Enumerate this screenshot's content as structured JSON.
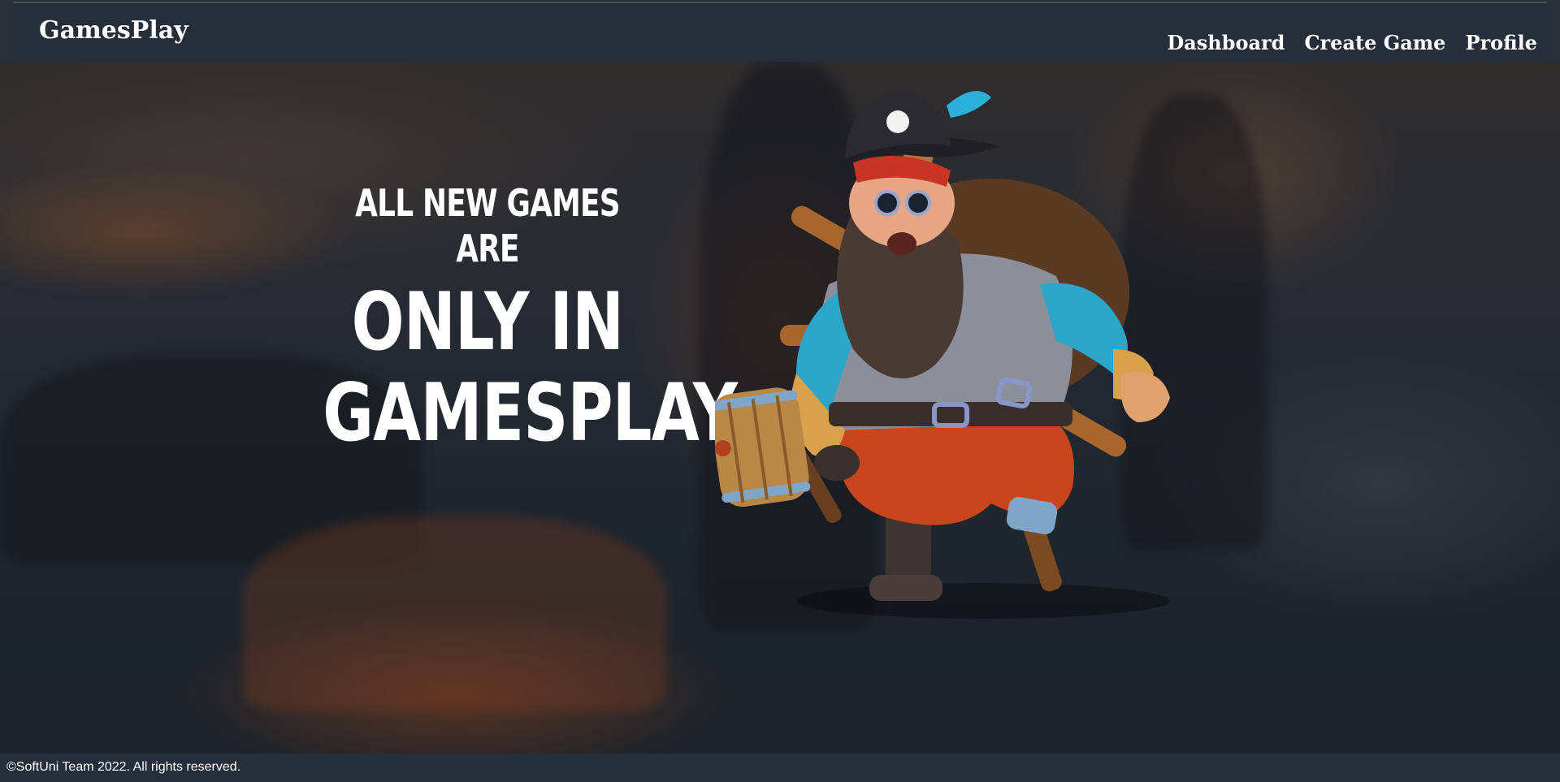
{
  "header": {
    "logo": "GamesPlay",
    "nav": {
      "dashboard": "Dashboard",
      "create_game": "Create Game",
      "profile": "Profile"
    }
  },
  "hero": {
    "line1": "ALL NEW GAMES ARE",
    "line2": "ONLY IN",
    "line3": "GAMESPLAY"
  },
  "footer": {
    "copyright": "©SoftUni Team 2022. All rights reserved."
  },
  "colors": {
    "header_bg": "#272e3b",
    "text": "#ffffff"
  }
}
